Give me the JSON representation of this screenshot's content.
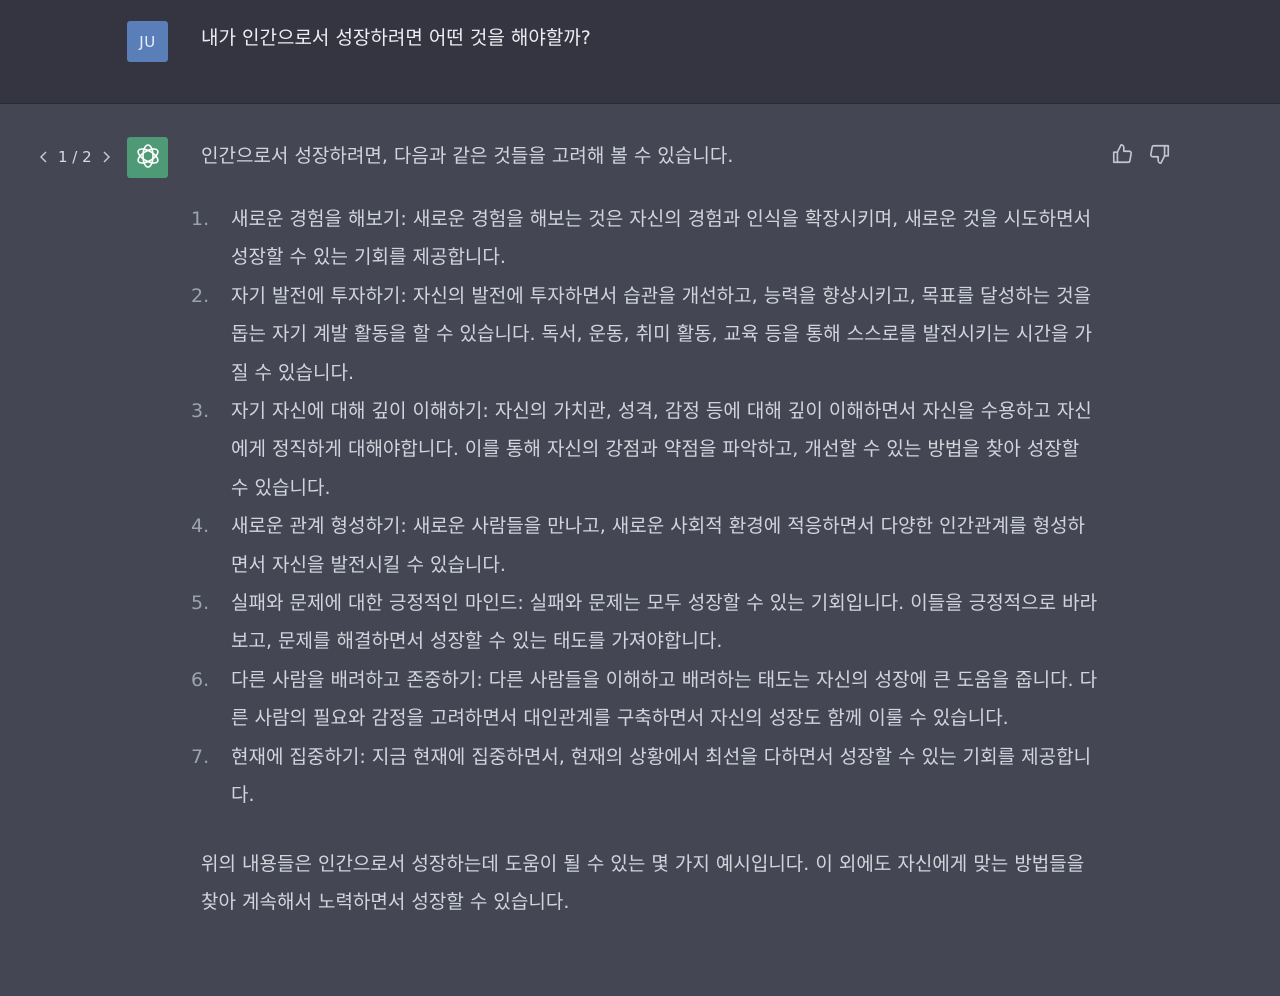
{
  "user": {
    "avatar_initials": "JU",
    "message": "내가 인간으로서 성장하려면 어떤 것을 해야할까?"
  },
  "assistant": {
    "pager": "1 / 2",
    "intro": "인간으로서 성장하려면, 다음과 같은 것들을 고려해 볼 수 있습니다.",
    "items": [
      {
        "num": "1.",
        "text": "새로운 경험을 해보기: 새로운 경험을 해보는 것은 자신의 경험과 인식을 확장시키며, 새로운 것을 시도하면서 성장할 수 있는 기회를 제공합니다."
      },
      {
        "num": "2.",
        "text": "자기 발전에 투자하기: 자신의 발전에 투자하면서 습관을 개선하고, 능력을 향상시키고, 목표를 달성하는 것을 돕는 자기 계발 활동을 할 수 있습니다. 독서, 운동, 취미 활동, 교육 등을 통해 스스로를 발전시키는 시간을 가질 수 있습니다."
      },
      {
        "num": "3.",
        "text": "자기 자신에 대해 깊이 이해하기: 자신의 가치관, 성격, 감정 등에 대해 깊이 이해하면서 자신을 수용하고 자신에게 정직하게 대해야합니다. 이를 통해 자신의 강점과 약점을 파악하고, 개선할 수 있는 방법을 찾아 성장할 수 있습니다."
      },
      {
        "num": "4.",
        "text": "새로운 관계 형성하기: 새로운 사람들을 만나고, 새로운 사회적 환경에 적응하면서 다양한 인간관계를 형성하면서 자신을 발전시킬 수 있습니다."
      },
      {
        "num": "5.",
        "text": "실패와 문제에 대한 긍정적인 마인드: 실패와 문제는 모두 성장할 수 있는 기회입니다. 이들을 긍정적으로 바라보고, 문제를 해결하면서 성장할 수 있는 태도를 가져야합니다."
      },
      {
        "num": "6.",
        "text": "다른 사람을 배려하고 존중하기: 다른 사람들을 이해하고 배려하는 태도는 자신의 성장에 큰 도움을 줍니다. 다른 사람의 필요와 감정을 고려하면서 대인관계를 구축하면서 자신의 성장도 함께 이룰 수 있습니다."
      },
      {
        "num": "7.",
        "text": "현재에 집중하기: 지금 현재에 집중하면서, 현재의 상황에서 최선을 다하면서 성장할 수 있는 기회를 제공합니다."
      }
    ],
    "outro": "위의 내용들은 인간으로서 성장하는데 도움이 될 수 있는 몇 가지 예시입니다. 이 외에도 자신에게 맞는 방법들을 찾아 계속해서 노력하면서 성장할 수 있습니다."
  },
  "icons": {
    "prev": "chevron-left-icon",
    "next": "chevron-right-icon",
    "assistant_logo": "openai-logo-icon",
    "thumbs_up": "thumbs-up-icon",
    "thumbs_down": "thumbs-down-icon"
  },
  "colors": {
    "user_bg": "#343541",
    "assistant_bg": "#444654",
    "user_avatar": "#5a7fb8",
    "assistant_avatar": "#4e9a76"
  }
}
